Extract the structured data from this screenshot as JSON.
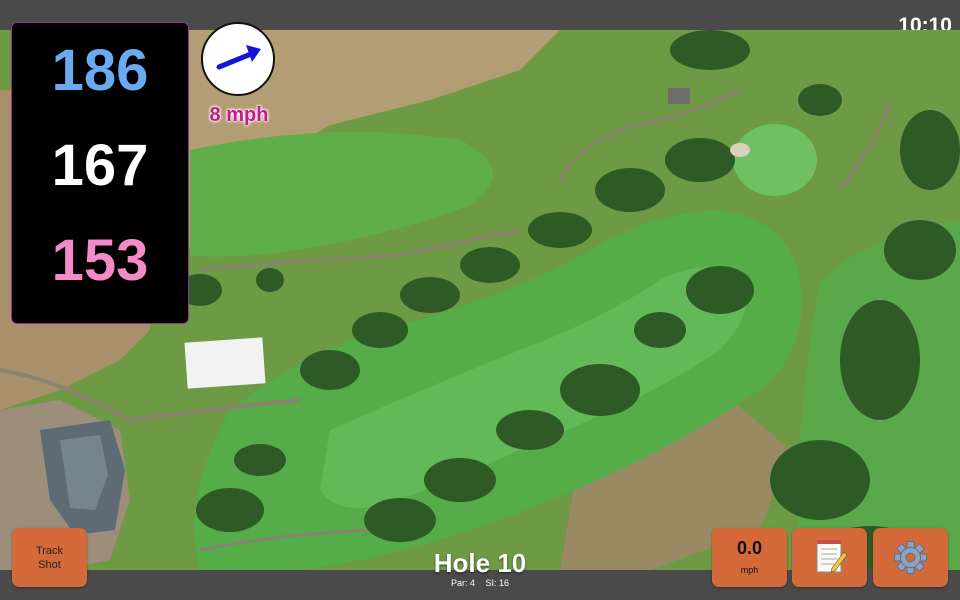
{
  "status": {
    "time": "10:10"
  },
  "distances": {
    "back": "186",
    "middle": "167",
    "front": "153"
  },
  "wind": {
    "speed_label": "8 mph",
    "direction_icon": "arrow-east-northeast-icon"
  },
  "hole": {
    "title": "Hole 10",
    "par": "Par: 4",
    "stroke_index": "SI: 16"
  },
  "buttons": {
    "track_shot_line1": "Track",
    "track_shot_line2": "Shot",
    "speed_value": "0.0",
    "speed_unit": "mph",
    "notes_icon": "notepad-icon",
    "settings_icon": "gear-icon"
  },
  "colors": {
    "back_distance": "#6aaaf0",
    "middle_distance": "#ffffff",
    "front_distance": "#f58ac8",
    "wind_label": "#c8188f",
    "button": "#d4693a"
  }
}
